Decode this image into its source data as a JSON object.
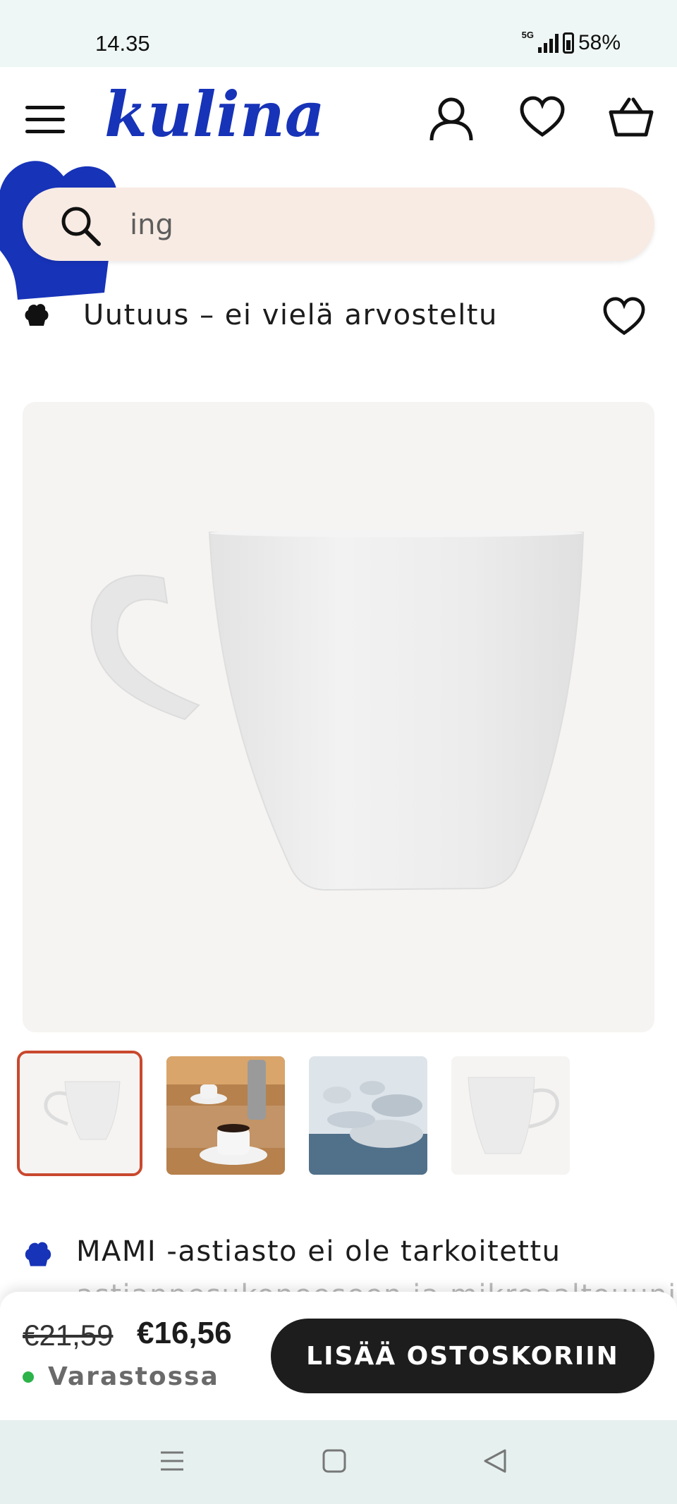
{
  "status": {
    "time": "14.35",
    "network": "5G",
    "battery": "58%"
  },
  "header": {
    "logo": "kulina"
  },
  "search": {
    "value": "ing"
  },
  "product": {
    "badge_text": "Uutuus – ei vielä arvosteltu",
    "notice_line1": "MAMI -astiasto ei ole tarkoitettu",
    "notice_line2": "astianpesukoneeseen ja mikroaaltouuniin"
  },
  "buybar": {
    "old_price": "€21,59",
    "price": "€16,56",
    "stock": "Varastossa",
    "add_to_cart": "LISÄÄ OSTOSKORIIN"
  },
  "colors": {
    "brand_blue": "#1733b8",
    "search_bg": "#f8ebe3",
    "active_thumb": "#c9482e",
    "button": "#1d1d1d",
    "in_stock": "#2cb34a"
  },
  "icons": [
    "menu-icon",
    "account-icon",
    "heart-icon",
    "basket-icon",
    "search-icon",
    "chef-hat-icon"
  ]
}
